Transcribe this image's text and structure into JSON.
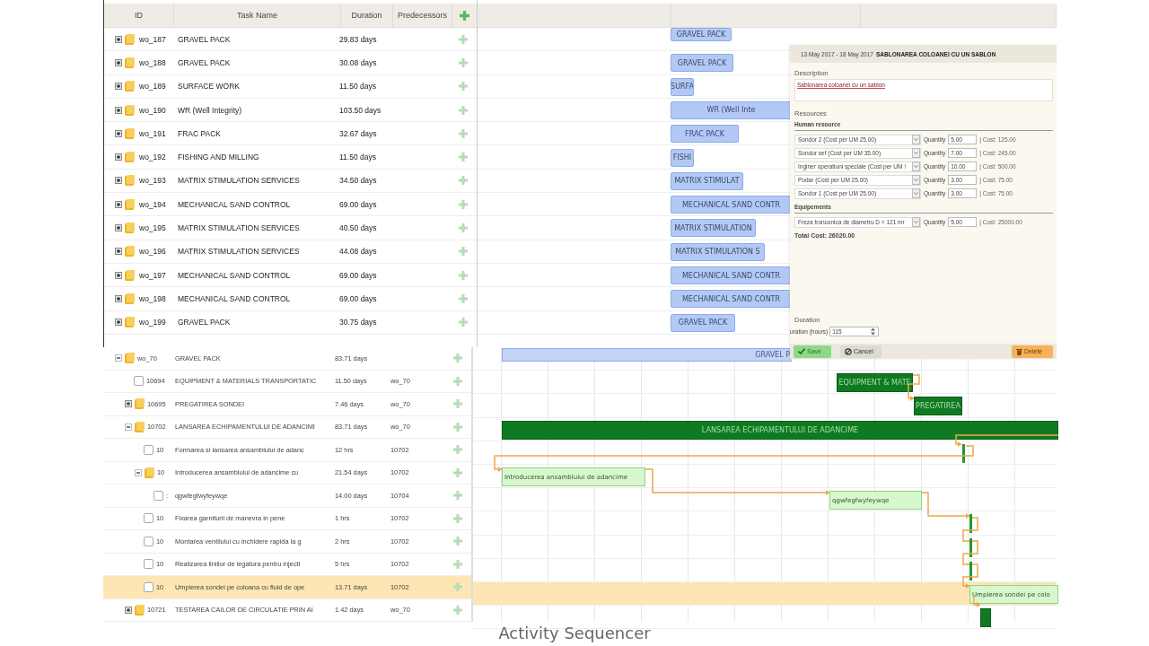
{
  "top_grid": {
    "columns": [
      "ID",
      "Task Name",
      "Duration",
      "Predecessors"
    ],
    "rows": [
      {
        "id": "wo_187",
        "name": "GRAVEL PACK",
        "duration": "29.83 days",
        "expanded": false,
        "bar": {
          "label": "GRAVEL PACK"
        }
      },
      {
        "id": "wo_188",
        "name": "GRAVEL PACK",
        "duration": "30.08 days",
        "expanded": false,
        "bar": {
          "label": "GRAVEL PACK"
        }
      },
      {
        "id": "wo_189",
        "name": "SURFACE WORK",
        "duration": "11.50 days",
        "expanded": false,
        "bar": {
          "label": "SURFA"
        }
      },
      {
        "id": "wo_190",
        "name": "WR (Well Integrity)",
        "duration": "103.50 days",
        "expanded": false,
        "bar": {
          "label": "WR (Well Inte"
        }
      },
      {
        "id": "wo_191",
        "name": "FRAC PACK",
        "duration": "32.67 days",
        "expanded": false,
        "bar": {
          "label": "FRAC PACK"
        }
      },
      {
        "id": "wo_192",
        "name": "FISHING AND MILLING",
        "duration": "11.50 days",
        "expanded": false,
        "bar": {
          "label": "FISHI"
        }
      },
      {
        "id": "wo_193",
        "name": "MATRIX STIMULATION SERVICES",
        "duration": "34.50 days",
        "expanded": false,
        "bar": {
          "label": "MATRIX STIMULAT"
        }
      },
      {
        "id": "wo_194",
        "name": "MECHANICAL SAND CONTROL",
        "duration": "69.00 days",
        "expanded": false,
        "bar": {
          "label": "MECHANICAL SAND CONTR"
        }
      },
      {
        "id": "wo_195",
        "name": "MATRIX STIMULATION SERVICES",
        "duration": "40.50 days",
        "expanded": false,
        "bar": {
          "label": "MATRIX STIMULATION"
        }
      },
      {
        "id": "wo_196",
        "name": "MATRIX STIMULATION SERVICES",
        "duration": "44.08 days",
        "expanded": false,
        "bar": {
          "label": "MATRIX STIMULATION S"
        }
      },
      {
        "id": "wo_197",
        "name": "MECHANICAL SAND CONTROL",
        "duration": "69.00 days",
        "expanded": false,
        "bar": {
          "label": "MECHANICAL SAND CONTR"
        }
      },
      {
        "id": "wo_198",
        "name": "MECHANICAL SAND CONTROL",
        "duration": "69.00 days",
        "expanded": false,
        "bar": {
          "label": "MECHANICAL SAND CONTR"
        }
      },
      {
        "id": "wo_199",
        "name": "GRAVEL PACK",
        "duration": "30.75 days",
        "expanded": false,
        "bar": {
          "label": "GRAVEL PACK"
        }
      }
    ]
  },
  "bottom_grid": {
    "rows": [
      {
        "kind": "folder",
        "id": "wo_70",
        "name": "GRAVEL PACK",
        "duration": "83.71 days",
        "expanded": true,
        "selected": false,
        "bar": {
          "kind": "summary",
          "label": "GRAVEL P"
        },
        "children": [
          {
            "kind": "task",
            "id": "10694",
            "name": "EQUIPMENT & MATERIALS TRANSPORTATIC",
            "duration": "11.50 days",
            "predecessors": "wo_70",
            "selected": false,
            "bar": {
              "kind": "group",
              "label": "EQUIPMENT & MATE"
            }
          },
          {
            "kind": "folder",
            "id": "10695",
            "name": "PREGATIREA SONDEI",
            "duration": "7.46 days",
            "predecessors": "wo_70",
            "expanded": false,
            "selected": false,
            "bar": {
              "kind": "group",
              "label": "PREGATIREA"
            }
          },
          {
            "kind": "folder",
            "id": "10702",
            "name": "LANSAREA ECHIPAMENTULUI DE ADANCIMI",
            "duration": "83.71 days",
            "predecessors": "wo_70",
            "expanded": true,
            "selected": false,
            "bar": {
              "kind": "group",
              "label": "LANSAREA ECHIPAMENTULUI DE ADANCIME"
            },
            "children": [
              {
                "kind": "task",
                "id": "10",
                "name": "Formarea si lansarea ansamblului de adanc",
                "duration": "12 hrs",
                "predecessors": "10702",
                "selected": false,
                "bar": {
                  "kind": "milestone"
                }
              },
              {
                "kind": "folder",
                "id": "10",
                "name": "Introducerea ansamblului de adancime cu",
                "duration": "21.54 days",
                "predecessors": "10702",
                "expanded": true,
                "selected": false,
                "bar": {
                  "kind": "task",
                  "label": "Introducerea ansamblului de adancime"
                },
                "children": [
                  {
                    "kind": "task",
                    "id": ":",
                    "name": "qgwfegfwyfeywqe",
                    "duration": "14.00 days",
                    "predecessors": "10704",
                    "selected": false,
                    "bar": {
                      "kind": "task",
                      "label": "qgwfegfwyfeywqe"
                    }
                  }
                ]
              },
              {
                "kind": "task",
                "id": "10",
                "name": "Fixarea garniturii de manevra in pene",
                "duration": "1 hrs",
                "predecessors": "10702",
                "selected": false,
                "bar": {
                  "kind": "milestone"
                }
              },
              {
                "kind": "task",
                "id": "10",
                "name": "Montarea ventilului cu inchidere rapida la g",
                "duration": "2 hrs",
                "predecessors": "10702",
                "selected": false,
                "bar": {
                  "kind": "milestone"
                }
              },
              {
                "kind": "task",
                "id": "10",
                "name": "Realizarea liniilor de legatura pentru injecti",
                "duration": "5 hrs",
                "predecessors": "10702",
                "selected": false,
                "bar": {
                  "kind": "milestone"
                }
              },
              {
                "kind": "task",
                "id": "10",
                "name": "Umplerea sondei pe coloana cu fluid de ope",
                "duration": "13.71 days",
                "predecessors": "10702",
                "selected": true,
                "bar": {
                  "kind": "task",
                  "label": "Umplerea sondei pe colo"
                }
              }
            ]
          },
          {
            "kind": "folder",
            "id": "10721",
            "name": "TESTAREA CAILOR DE CIRCULATIE PRIN AI",
            "duration": "1.42 days",
            "predecessors": "wo_70",
            "expanded": false,
            "selected": false,
            "bar": {
              "kind": "group"
            }
          }
        ]
      }
    ]
  },
  "dialog": {
    "dates": "13 May 2017 - 18 May 2017",
    "title": "SABLONAREA COLOANEI CU UN SABLON",
    "description_label": "Description",
    "description": "Sablonarea coloanei cu un sablon",
    "resources_label": "Resources",
    "human_label": "Human resource",
    "human": [
      {
        "resource": "Sondor 2 (Cost per UM 25.00)",
        "quantity_label": "Quantity",
        "quantity": "5.00",
        "cost": "| Cost: 125.00"
      },
      {
        "resource": "Sondor sef (Cost per UM 35.00)",
        "quantity_label": "Quantity",
        "quantity": "7.00",
        "cost": "| Cost: 245.00"
      },
      {
        "resource": "Inginer operatiuni speciale (Cost per UM !",
        "quantity_label": "Quantity",
        "quantity": "10.00",
        "cost": "| Cost: 500.00"
      },
      {
        "resource": "Podar (Cost per UM 25.00)",
        "quantity_label": "Quantity",
        "quantity": "3.00",
        "cost": "| Cost: 75.00"
      },
      {
        "resource": "Sondor 1 (Cost per UM 25.00)",
        "quantity_label": "Quantity",
        "quantity": "3.00",
        "cost": "| Cost: 75.00"
      }
    ],
    "equipment_label": "Equipements",
    "equipment": [
      {
        "resource": "Freza tronconica de diametru D = 121 mr",
        "quantity_label": "Quantity",
        "quantity": "5.00",
        "cost": "| Cost: 25000.00"
      }
    ],
    "total": "Total Cost: 26020.00",
    "duration_label": "Duration",
    "duration_field_label": "uration (hours)",
    "duration_value": "115",
    "buttons": {
      "save": "Save",
      "cancel": "Cancel",
      "delete": "Delete"
    }
  },
  "caption": "Activity Sequencer"
}
